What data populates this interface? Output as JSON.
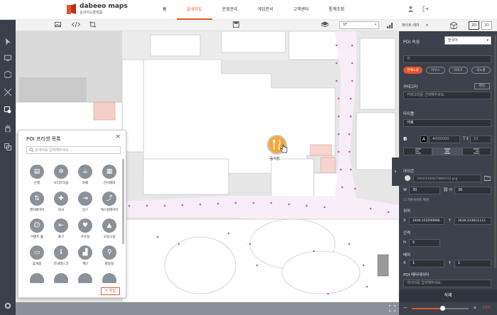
{
  "app": {
    "brand": "dabeeo maps",
    "subtitle": "실내지도플랫폼"
  },
  "nav": [
    {
      "label": "홈"
    },
    {
      "label": "실내지도",
      "active": true
    },
    {
      "label": "운영관리"
    },
    {
      "label": "게임문서"
    },
    {
      "label": "고객센터"
    },
    {
      "label": "통계조회"
    }
  ],
  "toolbar": {
    "floor": "1F"
  },
  "map": {
    "poi_label": "음식점",
    "zoom_label": "53%"
  },
  "poi_panel": {
    "title": "POI 프리셋 목록",
    "search_placeholder": "검색어를 입력해주세요.",
    "edit_button": "편집",
    "items": [
      {
        "label": "은행",
        "icon": "bank-icon"
      },
      {
        "label": "오디트리움",
        "icon": "auditorium-icon"
      },
      {
        "label": "카페",
        "icon": "cafe-icon"
      },
      {
        "label": "간이매대",
        "icon": "stall-icon"
      },
      {
        "label": "엘리베이터",
        "icon": "elevator-icon"
      },
      {
        "label": "약국",
        "icon": "pharmacy-icon"
      },
      {
        "label": "입구",
        "icon": "entrance-icon"
      },
      {
        "label": "에스컬레이터",
        "icon": "escalator-icon"
      },
      {
        "label": "이벤트 홀",
        "icon": "event-icon"
      },
      {
        "label": "출구",
        "icon": "exit-icon"
      },
      {
        "label": "수유실",
        "icon": "nursing-icon"
      },
      {
        "label": "소방시설",
        "icon": "fire-icon"
      },
      {
        "label": "휴게실",
        "icon": "lounge-icon"
      },
      {
        "label": "안내데스크",
        "icon": "info-icon"
      },
      {
        "label": "계단",
        "icon": "stairs-icon"
      },
      {
        "label": "화장실",
        "icon": "restroom-icon"
      }
    ]
  },
  "right_panel": {
    "theme": "화이트 테마",
    "view2d": "2D",
    "view3d": "3D",
    "attr_title": "POI 속성",
    "lang": "한국어",
    "visibility": "위",
    "tag_buttons": [
      "전체노출",
      "마우스",
      "마이크",
      "비노출"
    ],
    "category_title": "카테고리",
    "category_edit": "편집",
    "category_placeholder": "카테고리를 선택해주세요.",
    "title_label": "타이틀",
    "title_value": "카페",
    "text_color": "#000000",
    "font_size": "10",
    "icon_label": "아이콘",
    "icon_file": "1904161606278800153.png",
    "w_value": "30",
    "h_value": "30",
    "ratio_label": "기본사이즈 복원",
    "position_label": "위치",
    "pos_x": "2404.153599996",
    "pos_y": "2639.233611111",
    "spacing_label": "간격",
    "spacing_h": "5",
    "scale_label": "배치",
    "scale_x": "1",
    "scale_y": "1",
    "poi_meta_label": "POI 메타데이터",
    "meta_placeholder": "데이터를 입력해주세요.",
    "delete_button": "삭제",
    "zoom_percent": "53%"
  }
}
